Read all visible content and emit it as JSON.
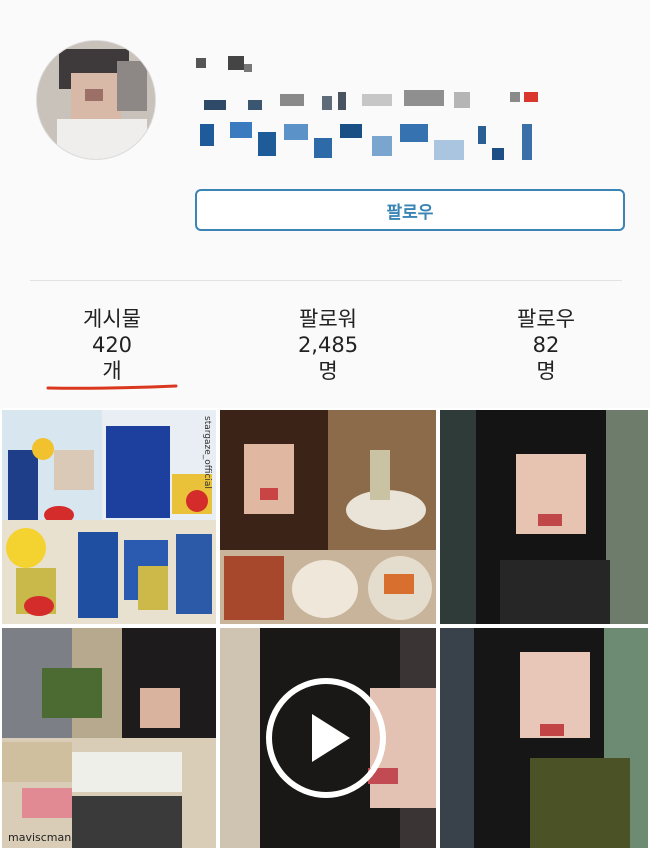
{
  "profile": {
    "follow_button_label": "팔로우",
    "stats": {
      "posts": {
        "label": "게시물",
        "value": "420",
        "unit": "개"
      },
      "followers": {
        "label": "팔로워",
        "value": "2,485",
        "unit": "명"
      },
      "following": {
        "label": "팔로우",
        "value": "82",
        "unit": "명"
      }
    },
    "underline_color": "#d9381e",
    "accent_color": "#3a84b6"
  },
  "grid": {
    "tile_captions": {
      "tile1_watermark": "stargaze_official",
      "tile4_username": "maviscman"
    },
    "video_icon": "play-icon"
  }
}
